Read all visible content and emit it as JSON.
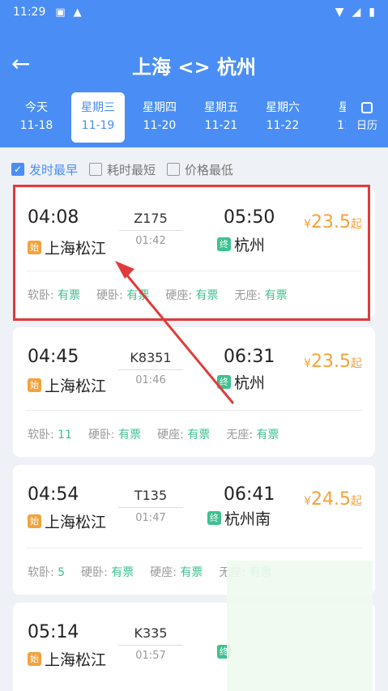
{
  "statusbar": {
    "time": "11:29",
    "left_icons": [
      "text-square-icon",
      "alert-triangle-icon"
    ],
    "right_icons": [
      "wifi-icon",
      "signal-icon",
      "battery-icon"
    ]
  },
  "nav": {
    "title": "上海 <> 杭州"
  },
  "dates": [
    {
      "week": "今天",
      "date": "11-18",
      "selected": false
    },
    {
      "week": "星期三",
      "date": "11-19",
      "selected": true
    },
    {
      "week": "星期四",
      "date": "11-20",
      "selected": false
    },
    {
      "week": "星期五",
      "date": "11-21",
      "selected": false
    },
    {
      "week": "星期六",
      "date": "11-22",
      "selected": false
    },
    {
      "week": "星",
      "date": "11",
      "selected": false
    }
  ],
  "calendar": {
    "label": "日历"
  },
  "filters": [
    {
      "label": "发时最早",
      "checked": true
    },
    {
      "label": "耗时最短",
      "checked": false
    },
    {
      "label": "价格最低",
      "checked": false
    }
  ],
  "trains": [
    {
      "dep_time": "04:08",
      "arr_time": "05:50",
      "train_no": "Z175",
      "duration": "01:42",
      "from": "上海松江",
      "to": "杭州",
      "from_badge": "始",
      "to_badge": "终",
      "price": "23.5",
      "currency": "¥",
      "price_suffix": "起",
      "seats": [
        {
          "type": "软卧: ",
          "value": "有票"
        },
        {
          "type": "硬卧: ",
          "value": "有票"
        },
        {
          "type": "硬座: ",
          "value": "有票"
        },
        {
          "type": "无座: ",
          "value": "有票"
        }
      ]
    },
    {
      "dep_time": "04:45",
      "arr_time": "06:31",
      "train_no": "K8351",
      "duration": "01:46",
      "from": "上海松江",
      "to": "杭州",
      "from_badge": "始",
      "to_badge": "终",
      "price": "23.5",
      "currency": "¥",
      "price_suffix": "起",
      "seats": [
        {
          "type": "软卧: ",
          "value": "11"
        },
        {
          "type": "硬卧: ",
          "value": "有票"
        },
        {
          "type": "硬座: ",
          "value": "有票"
        },
        {
          "type": "无座: ",
          "value": "有票"
        }
      ]
    },
    {
      "dep_time": "04:54",
      "arr_time": "06:41",
      "train_no": "T135",
      "duration": "01:47",
      "from": "上海松江",
      "to": "杭州南",
      "from_badge": "始",
      "to_badge": "终",
      "price": "24.5",
      "currency": "¥",
      "price_suffix": "起",
      "seats": [
        {
          "type": "软卧: ",
          "value": "5"
        },
        {
          "type": "硬卧: ",
          "value": "有票"
        },
        {
          "type": "硬座: ",
          "value": "有票"
        },
        {
          "type": "无座: ",
          "value": "有票"
        }
      ]
    },
    {
      "dep_time": "05:14",
      "arr_time": "",
      "train_no": "K335",
      "duration": "01:57",
      "from": "上海松江",
      "to": "",
      "from_badge": "始",
      "to_badge": "终",
      "price": "",
      "currency": "",
      "price_suffix": "",
      "seats": []
    }
  ],
  "colors": {
    "primary": "#4a8ef5",
    "price": "#f4a23b",
    "available": "#3ec18f",
    "highlight": "#e03b3b"
  }
}
